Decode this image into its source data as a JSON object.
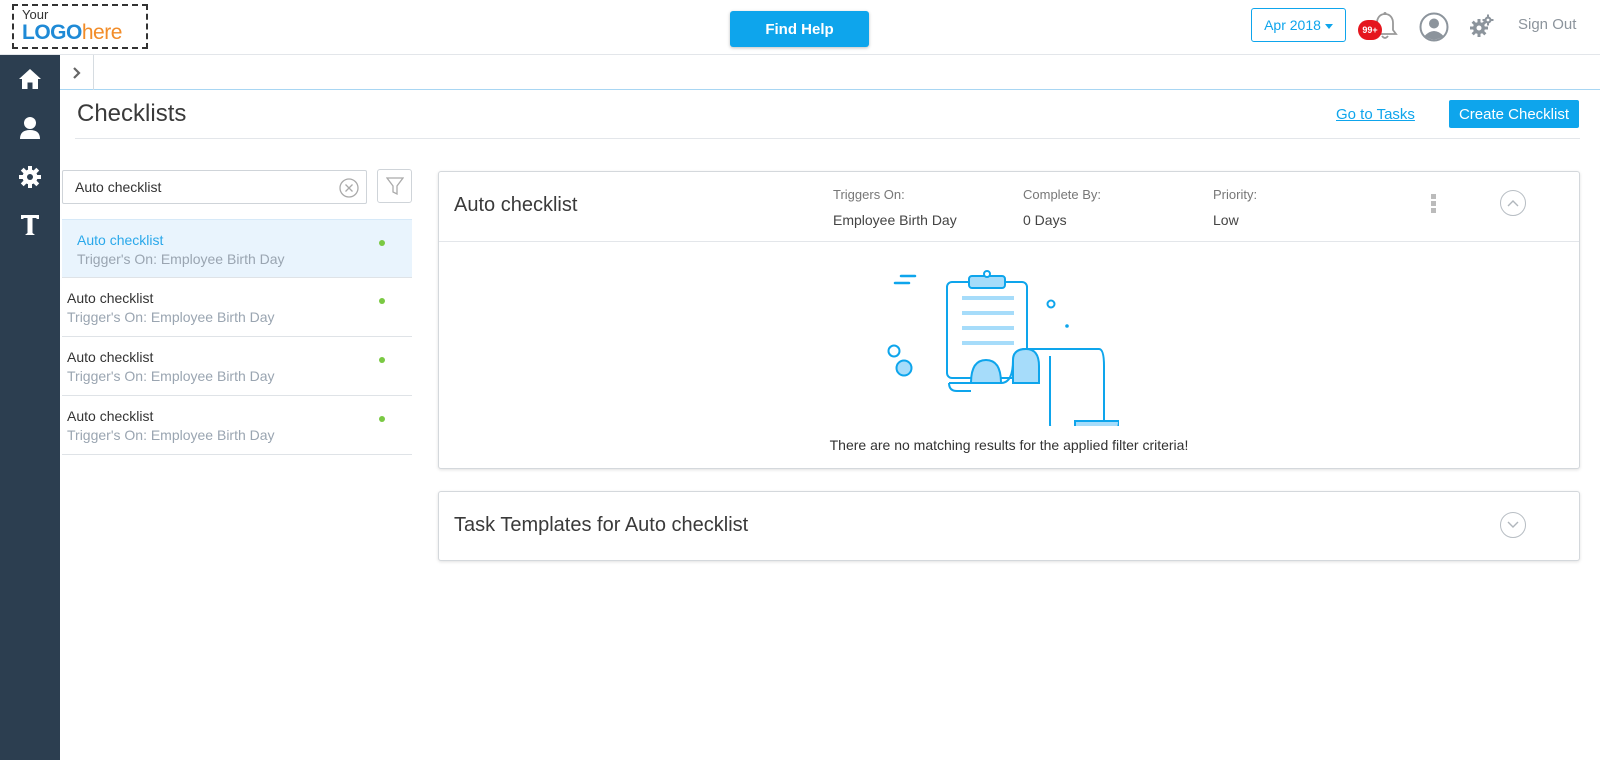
{
  "brand": {
    "logo_small": "Your",
    "logo_main_a": "LOGO",
    "logo_main_b": "here"
  },
  "topbar": {
    "find_help": "Find Help",
    "period": "Apr 2018",
    "notifications_badge": "99+",
    "sign_out": "Sign Out"
  },
  "sidenav": {
    "items": [
      {
        "icon": "home-icon"
      },
      {
        "icon": "user-icon"
      },
      {
        "icon": "settings-icon"
      },
      {
        "icon": "text-icon"
      }
    ]
  },
  "header": {
    "title": "Checklists",
    "go_to_tasks": "Go to Tasks",
    "create_checklist": "Create Checklist"
  },
  "search": {
    "value": "Auto checklist"
  },
  "checklists": [
    {
      "name": "Auto checklist",
      "trigger": "Trigger's On: Employee Birth Day",
      "selected": true
    },
    {
      "name": "Auto checklist",
      "trigger": "Trigger's On: Employee Birth Day",
      "selected": false
    },
    {
      "name": "Auto checklist",
      "trigger": "Trigger's On: Employee Birth Day",
      "selected": false
    },
    {
      "name": "Auto checklist",
      "trigger": "Trigger's On: Employee Birth Day",
      "selected": false
    }
  ],
  "detail": {
    "title": "Auto checklist",
    "triggers_on_label": "Triggers On:",
    "triggers_on_value": "Employee Birth Day",
    "complete_by_label": "Complete By:",
    "complete_by_value": "0 Days",
    "priority_label": "Priority:",
    "priority_value": "Low",
    "empty_message": "There are no matching results for the applied filter criteria!"
  },
  "templates_panel": {
    "title": "Task Templates for Auto checklist"
  },
  "colors": {
    "accent": "#0ea5ec",
    "sidenav": "#2c3e50",
    "active_dot": "#7ac943",
    "badge": "#e5161e"
  }
}
